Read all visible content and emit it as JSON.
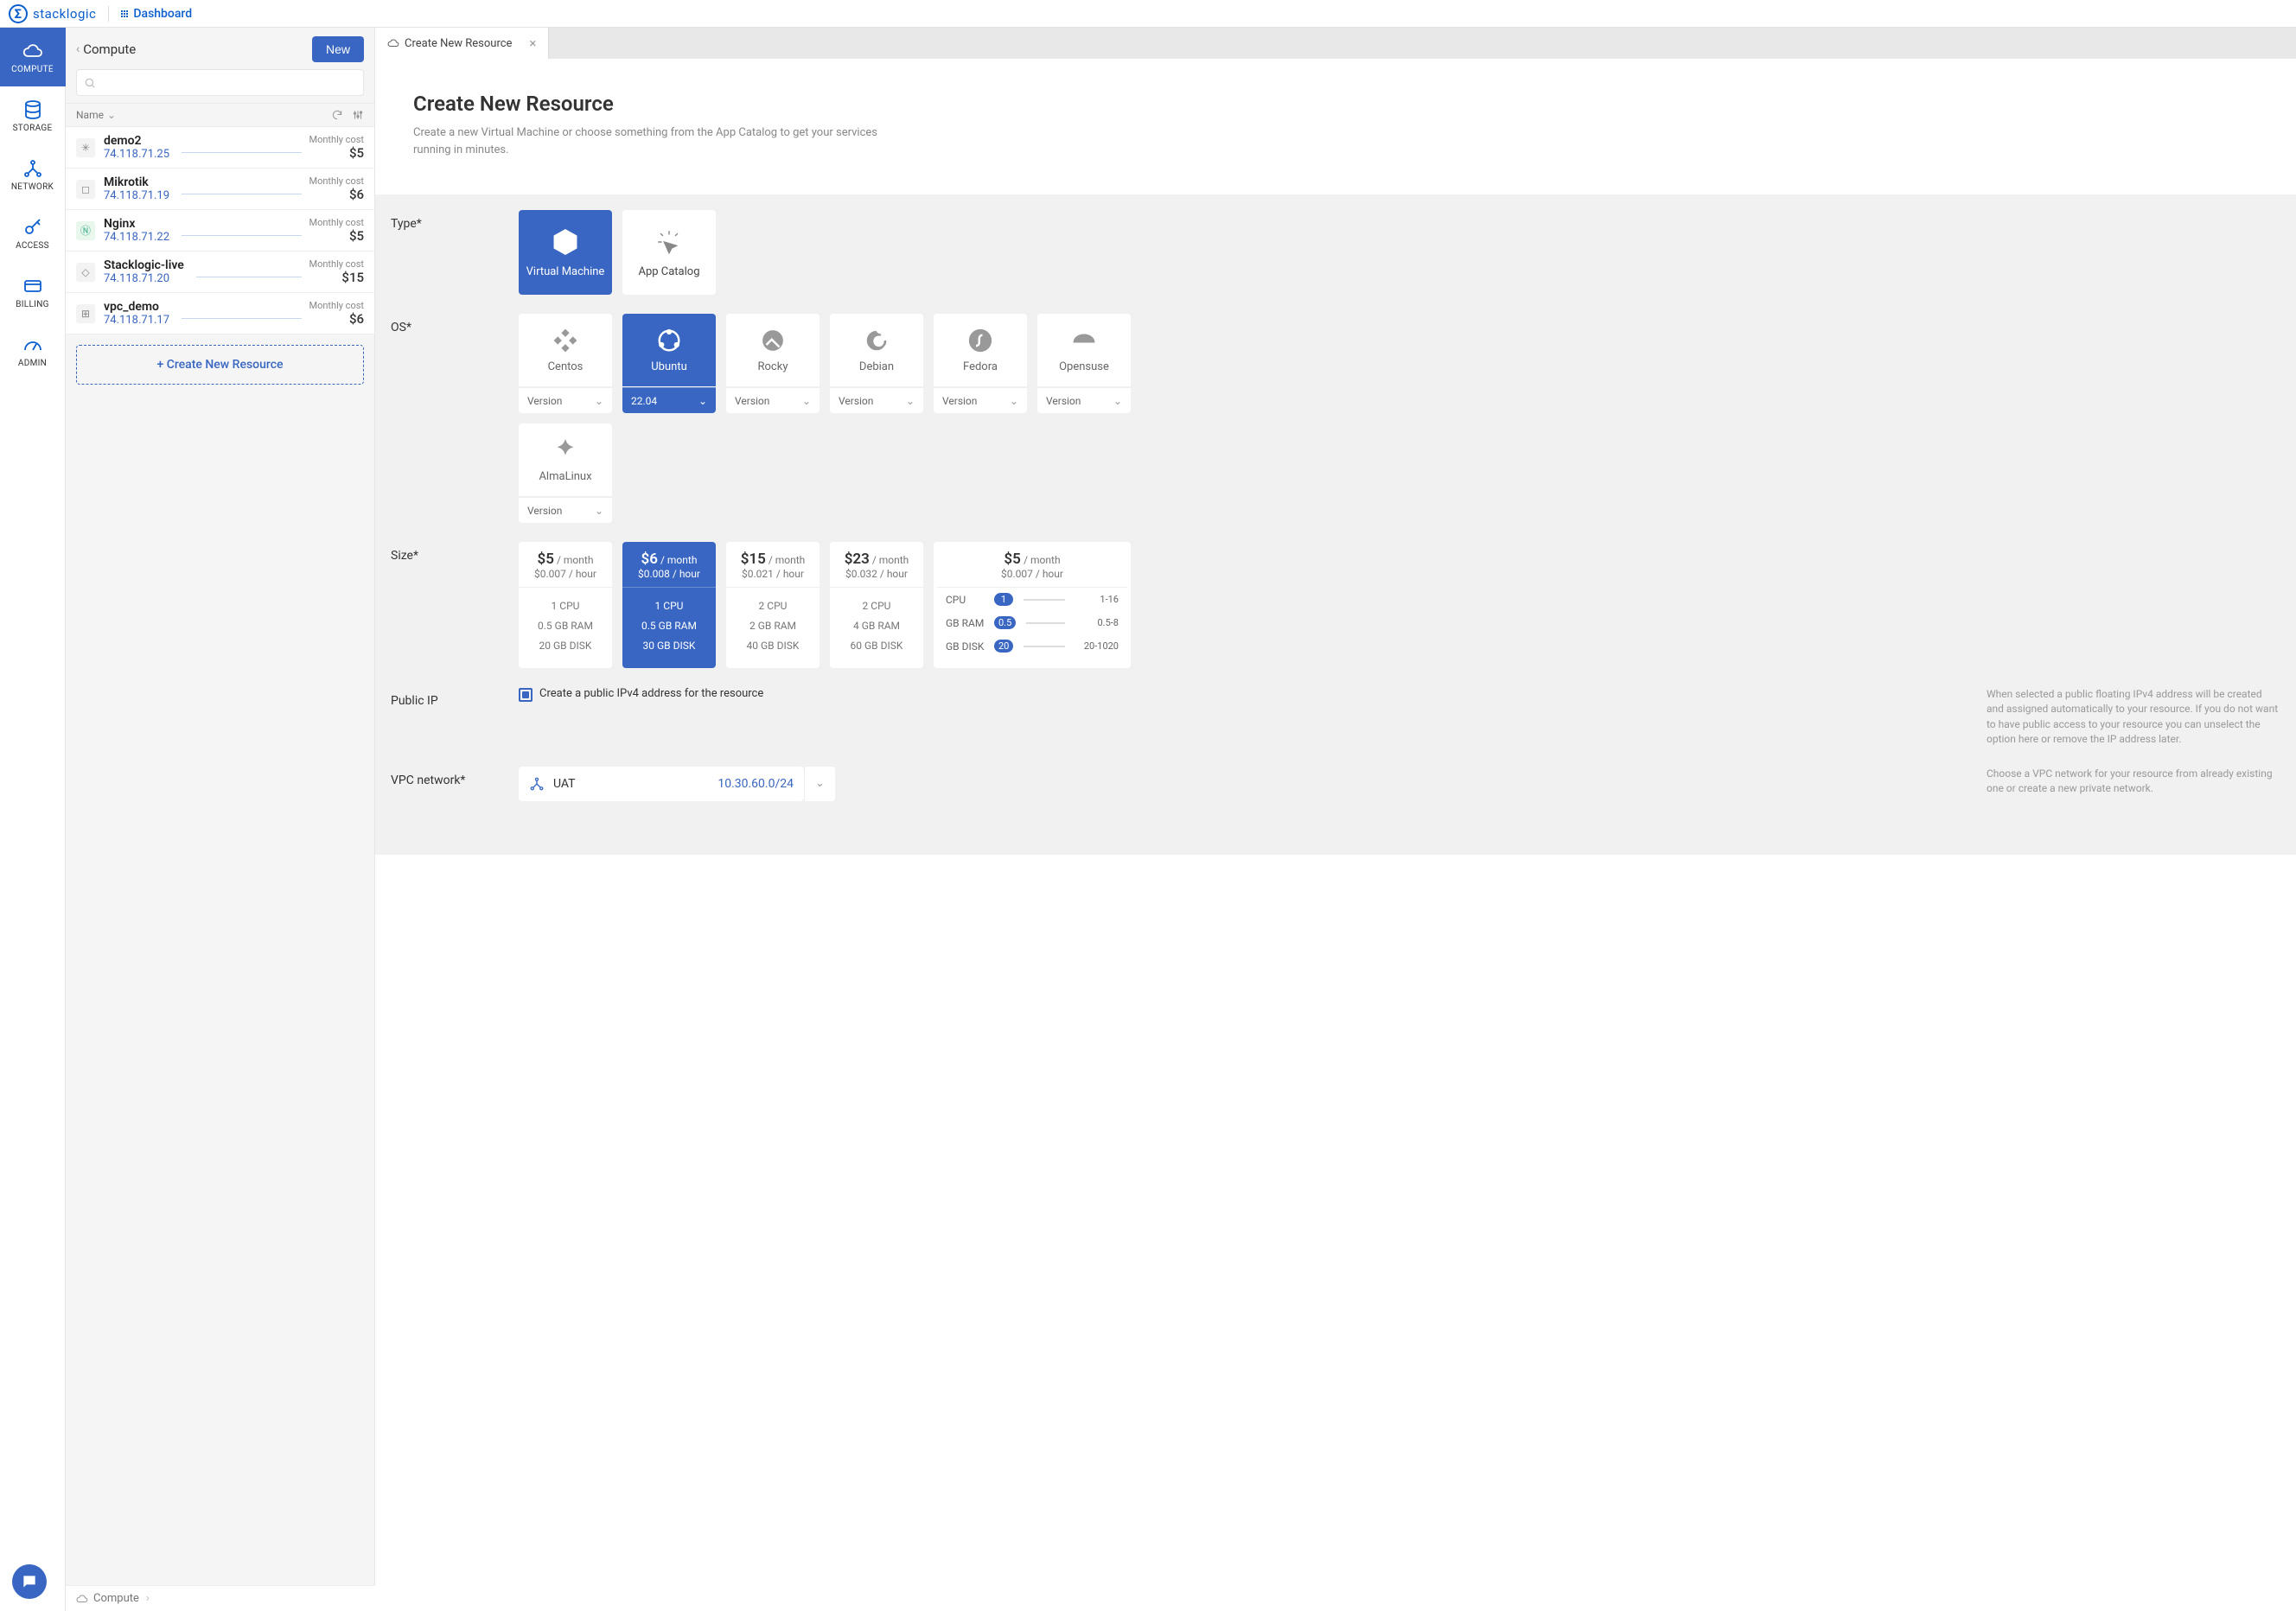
{
  "brand": "stacklogic",
  "dashboard_label": "Dashboard",
  "nav": [
    {
      "label": "COMPUTE",
      "active": true
    },
    {
      "label": "STORAGE"
    },
    {
      "label": "NETWORK"
    },
    {
      "label": "ACCESS"
    },
    {
      "label": "BILLING"
    },
    {
      "label": "ADMIN"
    }
  ],
  "list_panel": {
    "title": "Compute",
    "new_button": "New",
    "search_placeholder": "",
    "name_col": "Name",
    "cost_label": "Monthly cost",
    "resources": [
      {
        "name": "demo2",
        "ip": "74.118.71.25",
        "cost": "$5"
      },
      {
        "name": "Mikrotik",
        "ip": "74.118.71.19",
        "cost": "$6"
      },
      {
        "name": "Nginx",
        "ip": "74.118.71.22",
        "cost": "$5"
      },
      {
        "name": "Stacklogic-live",
        "ip": "74.118.71.20",
        "cost": "$15"
      },
      {
        "name": "vpc_demo",
        "ip": "74.118.71.17",
        "cost": "$6"
      }
    ],
    "create_button": "+ Create New Resource"
  },
  "breadcrumb": "Compute",
  "tab": {
    "title": "Create New Resource"
  },
  "page": {
    "title": "Create New Resource",
    "subtitle": "Create a new Virtual Machine or choose something from the App Catalog to get your services running in minutes."
  },
  "form": {
    "type_label": "Type*",
    "types": [
      {
        "label": "Virtual Machine",
        "active": true
      },
      {
        "label": "App Catalog"
      }
    ],
    "os_label": "OS*",
    "os": [
      {
        "label": "Centos",
        "version": "Version"
      },
      {
        "label": "Ubuntu",
        "version": "22.04",
        "active": true
      },
      {
        "label": "Rocky",
        "version": "Version"
      },
      {
        "label": "Debian",
        "version": "Version"
      },
      {
        "label": "Fedora",
        "version": "Version"
      },
      {
        "label": "Opensuse",
        "version": "Version"
      },
      {
        "label": "AlmaLinux",
        "version": "Version"
      }
    ],
    "size_label": "Size*",
    "sizes": [
      {
        "price": "$5",
        "unit": "/ month",
        "hourly": "$0.007 / hour",
        "cpu": "1 CPU",
        "ram": "0.5 GB RAM",
        "disk": "20 GB DISK"
      },
      {
        "price": "$6",
        "unit": "/ month",
        "hourly": "$0.008 / hour",
        "cpu": "1 CPU",
        "ram": "0.5 GB RAM",
        "disk": "30 GB DISK",
        "active": true
      },
      {
        "price": "$15",
        "unit": "/ month",
        "hourly": "$0.021 / hour",
        "cpu": "2 CPU",
        "ram": "2 GB RAM",
        "disk": "40 GB DISK"
      },
      {
        "price": "$23",
        "unit": "/ month",
        "hourly": "$0.032 / hour",
        "cpu": "2 CPU",
        "ram": "4 GB RAM",
        "disk": "60 GB DISK"
      }
    ],
    "size_custom": {
      "price": "$5",
      "unit": "/ month",
      "hourly": "$0.007 / hour",
      "rows": [
        {
          "label": "CPU",
          "value": "1",
          "range": "1-16"
        },
        {
          "label": "GB RAM",
          "value": "0.5",
          "range": "0.5-8"
        },
        {
          "label": "GB DISK",
          "value": "20",
          "range": "20-1020"
        }
      ]
    },
    "public_ip_label": "Public IP",
    "public_ip_text": "Create a public IPv4 address for the resource",
    "public_ip_hint": "When selected a public floating IPv4 address will be created and assigned automatically to your resource. If you do not want to have public access to your resource you can unselect the option here or remove the IP address later.",
    "vpc_label": "VPC network*",
    "vpc_name": "UAT",
    "vpc_cidr": "10.30.60.0/24",
    "vpc_hint": "Choose a VPC network for your resource from already existing one or create a new private network."
  }
}
